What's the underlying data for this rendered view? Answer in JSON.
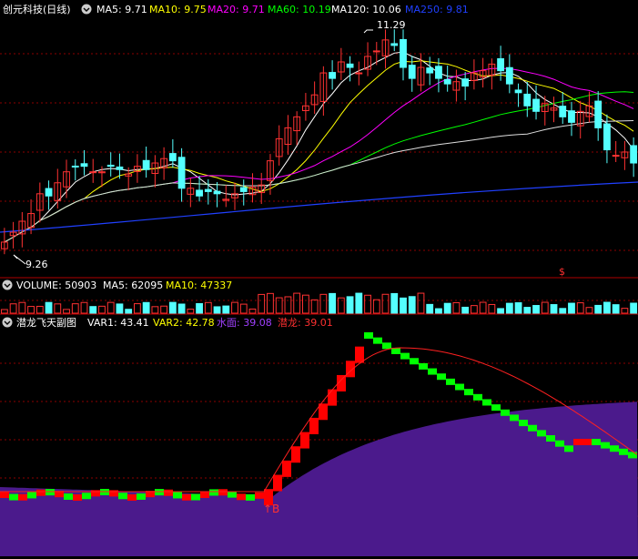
{
  "price_panel": {
    "title": "创元科技(日线)",
    "indicators": [
      {
        "label": "MA5: 9.71",
        "color": "#ffffff"
      },
      {
        "label": "MA10: 9.75",
        "color": "#ffff00"
      },
      {
        "label": "MA20: 9.71",
        "color": "#ff00ff"
      },
      {
        "label": "MA60: 10.19",
        "color": "#00ff00"
      },
      {
        "label": "MA120: 10.06",
        "color": "#ffffff"
      },
      {
        "label": "MA250: 9.81",
        "color": "#0000ff"
      }
    ],
    "high_marker": "11.29",
    "low_marker": "9.26",
    "signal_glyph": "$"
  },
  "volume_panel": {
    "indicators": [
      {
        "label": "VOLUME: 50903",
        "color": "#ffffff"
      },
      {
        "label": "MA5: 62095",
        "color": "#ffffff"
      },
      {
        "label": "MA10: 47337",
        "color": "#ffff00"
      }
    ]
  },
  "sub_panel": {
    "title": "潜龙飞天副图",
    "indicators": [
      {
        "label": "VAR1: 43.41",
        "color": "#ffffff"
      },
      {
        "label": "VAR2: 42.78",
        "color": "#ffff00"
      },
      {
        "label": "水面: 39.08",
        "color": "#a020f0"
      },
      {
        "label": "潜龙: 39.01",
        "color": "#ff3030"
      }
    ],
    "buy_marker": "↑B"
  },
  "colors": {
    "up": "#ff3232",
    "down": "#54ffff",
    "grid": "#8b0000",
    "panel_border": "#b00000",
    "water": "#4b1a8c",
    "green_step": "#00ff00",
    "red_step": "#ff0000"
  },
  "icons": {
    "panel_collapse": "chevron-down-circle-icon"
  }
}
